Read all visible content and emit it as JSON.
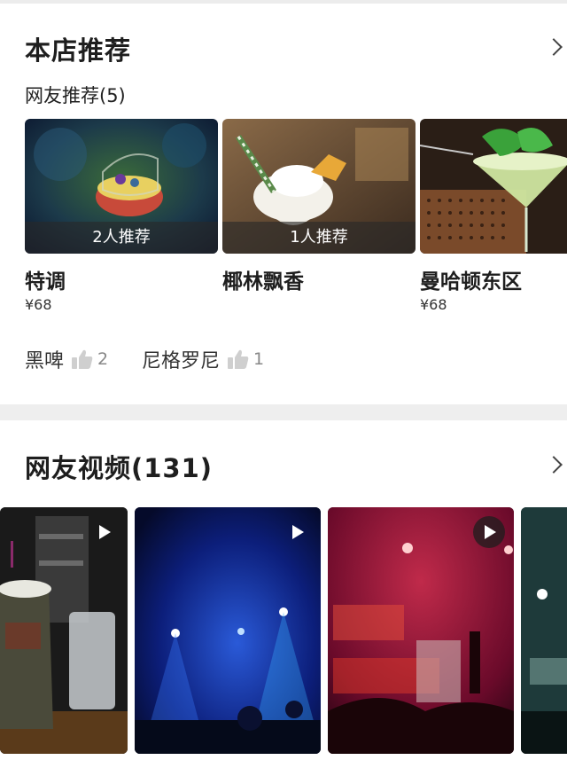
{
  "recommend": {
    "title": "本店推荐",
    "subtitle": "网友推荐(5)",
    "dishes": [
      {
        "name": "特调",
        "price": "¥68",
        "recommend_text": "2人推荐"
      },
      {
        "name": "椰林飘香",
        "price": "",
        "recommend_text": "1人推荐"
      },
      {
        "name": "曼哈顿东区",
        "price": "¥68",
        "recommend_text": ""
      }
    ],
    "tags": [
      {
        "name": "黑啤",
        "likes": "2"
      },
      {
        "name": "尼格罗尼",
        "likes": "1"
      }
    ]
  },
  "videos": {
    "title": "网友视频(131)"
  },
  "colors": {
    "divider": "#eeeeee",
    "rec_bar": "rgba(40,40,40,0.62)",
    "text_primary": "#1e1e1e",
    "text_secondary": "#888888"
  }
}
